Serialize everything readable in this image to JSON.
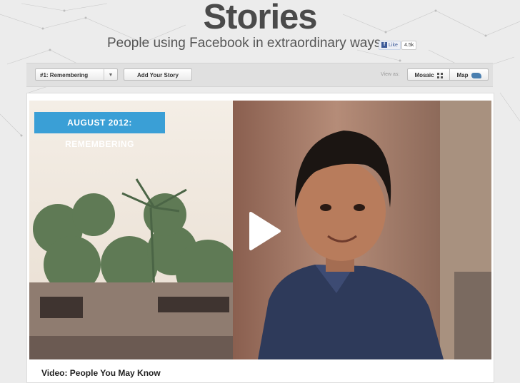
{
  "header": {
    "title": "Stories",
    "subtitle": "People using Facebook in extraordinary ways",
    "like_label": "Like",
    "like_count": "4.5k"
  },
  "toolbar": {
    "story_select": "#1: Remembering",
    "add_story": "Add Your Story",
    "view_as": "View as:",
    "mosaic": "Mosaic",
    "map": "Map"
  },
  "feature": {
    "badge_prefix": "AUGUST 2012: ",
    "badge_emphasis": "REMEMBERING",
    "caption": "Video: People You May Know"
  },
  "icons": {
    "play": "play-icon",
    "mosaic": "grid-icon",
    "map": "world-map-icon",
    "caret": "chevron-down-icon"
  },
  "colors": {
    "badge": "#3a9fd6",
    "facebook": "#3b5998"
  }
}
